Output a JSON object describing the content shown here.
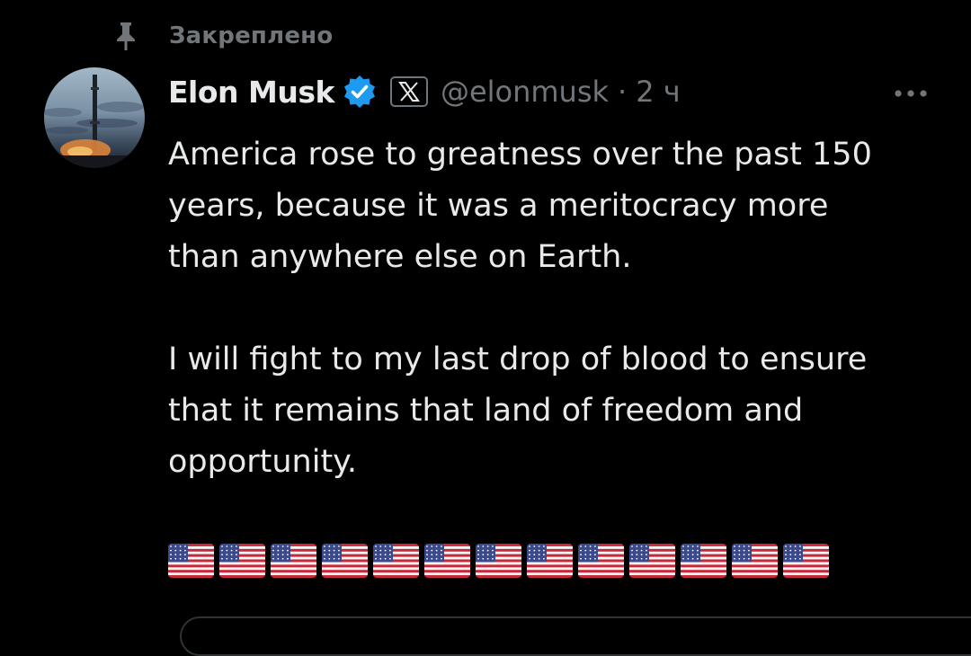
{
  "pinned": {
    "label": "Закреплено",
    "icon": "pin-icon"
  },
  "tweet": {
    "avatar_icon": "avatar-rocket-image",
    "author_name": "Elon Musk",
    "verified_icon": "verified-badge-icon",
    "verified_color": "#1d9bf0",
    "affiliate_icon": "x-logo-icon",
    "handle": "@elonmusk",
    "separator": "·",
    "time": "2 ч",
    "more_icon": "more-options-icon",
    "paragraphs": [
      "America rose to greatness over the past 150\nyears, because it was a meritocracy more\nthan anywhere else on Earth.",
      "I will fight to my last drop of blood to ensure\nthat it remains that land of freedom and\nopportunity."
    ],
    "flags": {
      "icon": "us-flag-icon",
      "count": 13
    }
  },
  "colors": {
    "background": "#000000",
    "primary_text": "#e7e9ea",
    "secondary_text": "#71767b"
  }
}
